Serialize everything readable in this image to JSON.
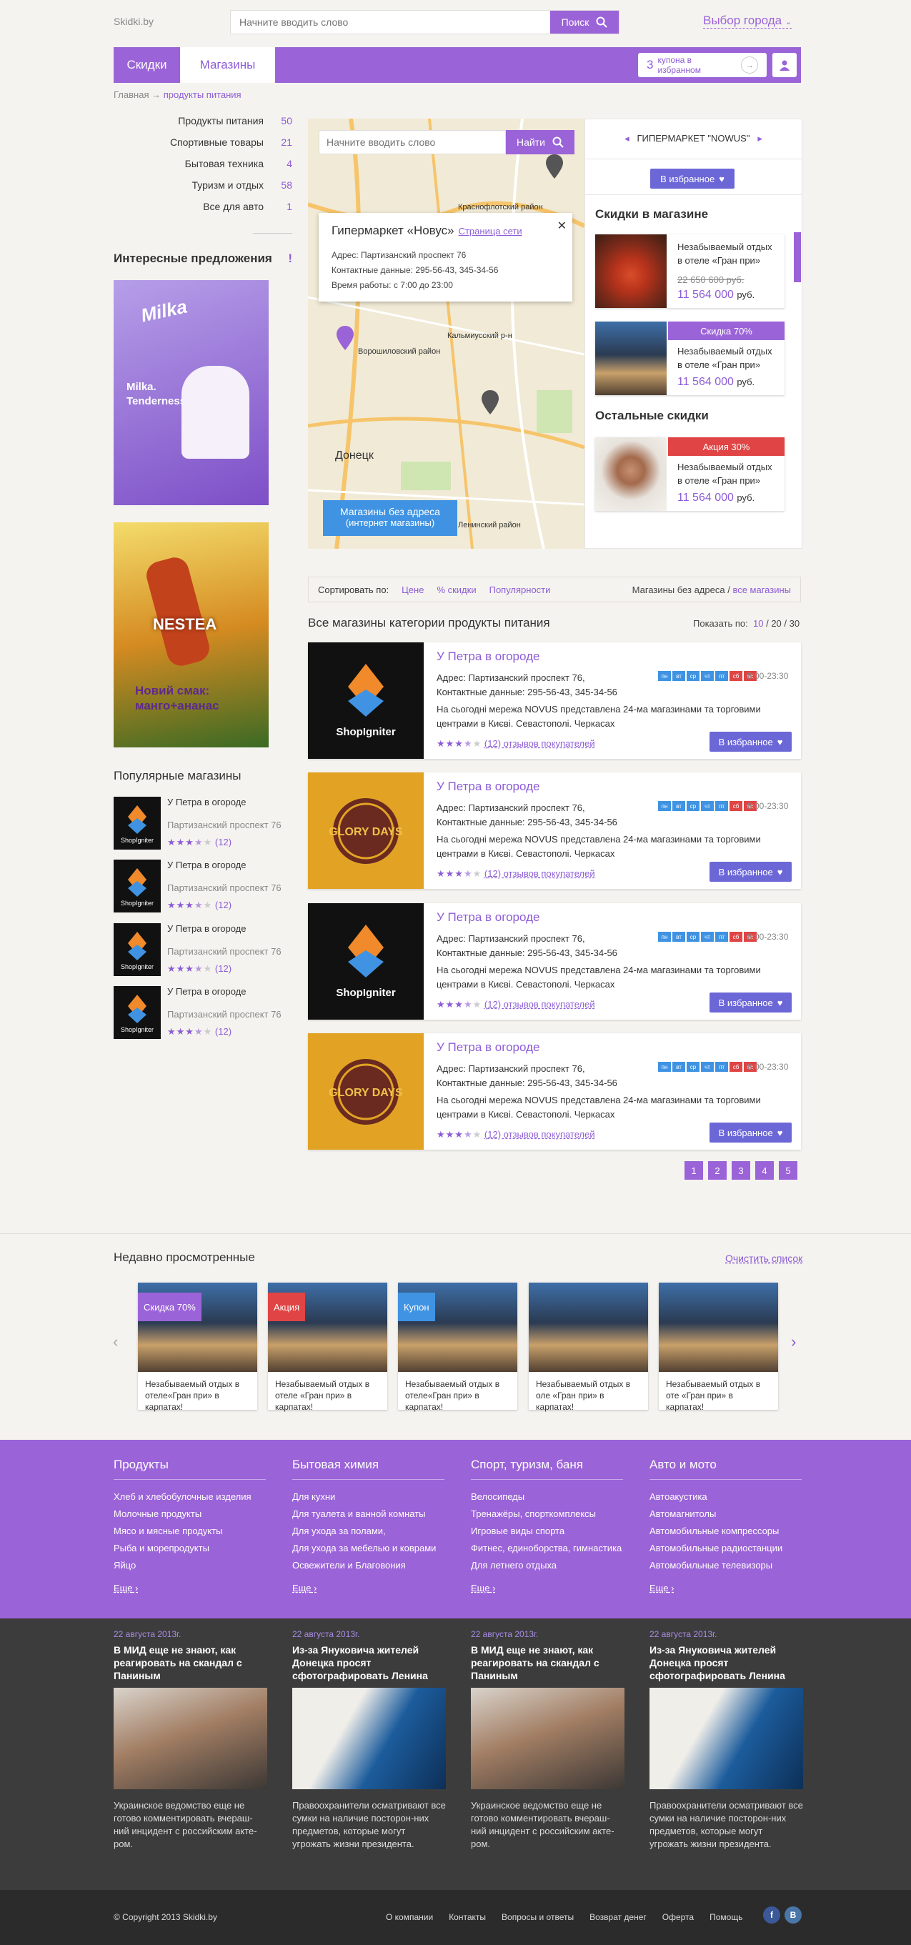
{
  "header": {
    "logo": "Skidki.by",
    "search_placeholder": "Начните вводить слово",
    "search_button": "Поиск",
    "city": "Выбор города",
    "tabs": [
      "Скидки",
      "Магазины"
    ],
    "fav_count": "3",
    "fav_text": "купона в избранном"
  },
  "breadcrumb": {
    "home": "Главная",
    "sep": "→",
    "current": "продукты питания"
  },
  "categories": [
    {
      "label": "Продукты питания",
      "count": "50"
    },
    {
      "label": "Спортивные товары",
      "count": "21"
    },
    {
      "label": "Бытовая техника",
      "count": "4"
    },
    {
      "label": "Туризм и отдых",
      "count": "58"
    },
    {
      "label": "Все для авто",
      "count": "1"
    }
  ],
  "interesting": {
    "title": "Интересные предложения",
    "mark": "!"
  },
  "ads": {
    "milka": {
      "brand": "Milka",
      "tagline": "Milka. Tenderness"
    },
    "nestea": {
      "brand": "NESTEA",
      "tagline": "Новий смак: манго+ананас"
    }
  },
  "popular": {
    "title": "Популярные магазины",
    "items": [
      {
        "name": "У Петра в огороде",
        "address": "Партизанский проспект 76",
        "reviews": "(12)",
        "logo": "ShopIgniter"
      },
      {
        "name": "У Петра в огороде",
        "address": "Партизанский проспект 76",
        "reviews": "(12)",
        "logo": "ShopIgniter"
      },
      {
        "name": "У Петра в огороде",
        "address": "Партизанский проспект 76",
        "reviews": "(12)",
        "logo": "ShopIgniter"
      },
      {
        "name": "У Петра в огороде",
        "address": "Партизанский проспект 76",
        "reviews": "(12)",
        "logo": "ShopIgniter"
      }
    ]
  },
  "map": {
    "search_placeholder": "Начните вводить слово",
    "search_button": "Найти",
    "city_labels": [
      "Донецк",
      "Ворошиловский район",
      "Кальмиусский р-н",
      "Ленинский район",
      "Краснофлотский район"
    ],
    "popup": {
      "title": "Гипермаркет «Новус»",
      "link": "Страница сети",
      "address": "Адрес: Партизанский проспект 76",
      "contacts": "Контактные данные: 295-56-43, 345-34-56",
      "hours": "Время работы: с 7:00 до 23:00"
    },
    "online_button": "Магазины без адреса",
    "online_sub": "(интернет магазины)"
  },
  "right_panel": {
    "store": "ГИПЕРМАРКЕТ \"NOWUS\"",
    "fav_button": "В избранное",
    "store_discounts_title": "Скидки в магазине",
    "other_title": "Остальные скидки",
    "deals": [
      {
        "text": "Незабываемый отдых в отеле «Гран при»",
        "old_price": "22 650 600 руб.",
        "price": "11 564 000",
        "currency": "руб.",
        "badge": ""
      },
      {
        "text": "Незабываемый отдых в отеле «Гран при»",
        "old_price": "",
        "price": "11 564 000",
        "currency": "руб.",
        "badge": "Скидка 70%"
      },
      {
        "text": "Незабываемый отдых в отеле «Гран при»",
        "old_price": "",
        "price": "11 564 000",
        "currency": "руб.",
        "badge": "Акция 30%"
      }
    ]
  },
  "sort": {
    "label": "Сортировать по:",
    "options": [
      "Цене",
      "% скидки",
      "Популярности"
    ],
    "no_address": "Магазины без адреса /",
    "all_stores": "все магазины"
  },
  "list": {
    "title": "Все магазины категории продукты питания",
    "show_label": "Показать по:",
    "show_options": [
      "10",
      "20",
      "30"
    ],
    "stores": [
      {
        "name": "У Петра в огороде",
        "address": "Адрес: Партизанский проспект 76,",
        "contacts": "Контактные данные:  295-56-43,  345-34-56",
        "desc": "На сьогодні мережа NOVUS представлена 24-ма магазинами та торговими центрами в Києві. Севастополі. Черкасах",
        "reviews": "(12) отзывов покупателей",
        "hours": "8:00-23:30",
        "fav": "В избранное",
        "logo": "ShopIgniter"
      },
      {
        "name": "У Петра в огороде",
        "address": "Адрес: Партизанский проспект 76,",
        "contacts": "Контактные данные:  295-56-43,  345-34-56",
        "desc": "На сьогодні мережа NOVUS представлена 24-ма магазинами та торговими центрами в Києві. Севастополі. Черкасах",
        "reviews": "(12) отзывов покупателей",
        "hours": "8:00-23:30",
        "fav": "В избранное",
        "logo": "GLORY DAYS"
      },
      {
        "name": "У Петра в огороде",
        "address": "Адрес: Партизанский проспект 76,",
        "contacts": "Контактные данные:  295-56-43,  345-34-56",
        "desc": "На сьогодні мережа NOVUS представлена 24-ма магазинами та торговими центрами в Києві. Севастополі. Черкасах",
        "reviews": "(12) отзывов покупателей",
        "hours": "8:00-23:30",
        "fav": "В избранное",
        "logo": "ShopIgniter"
      },
      {
        "name": "У Петра в огороде",
        "address": "Адрес: Партизанский проспект 76,",
        "contacts": "Контактные данные:  295-56-43,  345-34-56",
        "desc": "На сьогодні мережа NOVUS представлена 24-ма магазинами та торговими центрами в Києві. Севастополі. Черкасах",
        "reviews": "(12) отзывов покупателей",
        "hours": "8:00-23:30",
        "fav": "В избранное",
        "logo": "GLORY DAYS"
      }
    ],
    "days": [
      "пн",
      "вт",
      "ср",
      "чт",
      "пт",
      "сб",
      "вс"
    ]
  },
  "pager": [
    "1",
    "2",
    "3",
    "4",
    "5"
  ],
  "recent": {
    "title": "Недавно просмотренные",
    "clear": "Очистить список",
    "items": [
      {
        "badge": "Скидка 70%",
        "badge_color": "#9b63d8",
        "text": "Незабываемый отдых в отеле«Гран при» в карпатах!"
      },
      {
        "badge": "Акция",
        "badge_color": "#e04444",
        "text": "Незабываемый отдых в отеле «Гран при» в карпатах!"
      },
      {
        "badge": "Купон",
        "badge_color": "#3f93e2",
        "text": "Незабываемый отдых в отеле«Гран при» в карпатах!"
      },
      {
        "badge": "",
        "badge_color": "",
        "text": "Незабываемый отдых в оле «Гран при» в карпатах!"
      },
      {
        "badge": "",
        "badge_color": "",
        "text": "Незабываемый отдых в оте «Гран при» в карпатах!"
      }
    ]
  },
  "footer_cols": [
    {
      "title": "Продукты",
      "items": [
        "Хлеб и хлебобулочные изделия",
        "Молочные продукты",
        "Мясо и мясные продукты",
        "Рыба и морепродукты",
        "Яйцо"
      ],
      "more": "Еще"
    },
    {
      "title": "Бытовая химия",
      "items": [
        "Для кухни",
        "Для туалета и ванной комнаты",
        "Для ухода за полами,",
        "Для ухода за мебелью и коврами",
        "Освежители и Благовония"
      ],
      "more": "Еще"
    },
    {
      "title": "Спорт, туризм, баня",
      "items": [
        "Велосипеды",
        "Тренажёры, спорткомплексы",
        "Игровые виды спорта",
        "Фитнес, единоборства, гимнастика",
        "Для летнего отдыха"
      ],
      "more": "Еще"
    },
    {
      "title": "Авто и мото",
      "items": [
        "Автоакустика",
        "Автомагнитолы",
        "Автомобильные компрессоры",
        "Автомобильные радиостанции",
        "Автомобильные телевизоры"
      ],
      "more": "Еще"
    }
  ],
  "news": [
    {
      "date": "22 августа 2013г.",
      "title": "В МИД еще не знают, как реагировать на скандал с Паниным",
      "text": "Украинское ведомство еще не готово комментировать вчераш-ний инцидент с российским акте-ром."
    },
    {
      "date": "22 августа 2013г.",
      "title": "Из-за Януковича жителей Донецка просят сфотографировать Ленина",
      "text": "Правоохранители осматривают все сумки на наличие посторон-них предметов, которые могут угрожать жизни президента."
    },
    {
      "date": "22 августа 2013г.",
      "title": "В МИД еще не знают, как реагировать на скандал с Паниным",
      "text": "Украинское ведомство еще не готово комментировать вчераш-ний инцидент с российским акте-ром."
    },
    {
      "date": "22 августа 2013г.",
      "title": "Из-за Януковича жителей Донецка просят сфотографировать Ленина",
      "text": "Правоохранители осматривают все сумки на наличие посторон-них предметов, которые могут угрожать жизни президента."
    }
  ],
  "bottom": {
    "copyright": "© Copyright 2013 Skidki.by",
    "links": [
      "О компании",
      "Контакты",
      "Вопросы и ответы",
      "Возврат денег",
      "Оферта",
      "Помощь"
    ],
    "social": [
      "f",
      "В"
    ]
  },
  "colors": {
    "accent": "#9b63d8",
    "blue": "#3f93e2",
    "red": "#e04444",
    "button": "#6c67d7"
  }
}
